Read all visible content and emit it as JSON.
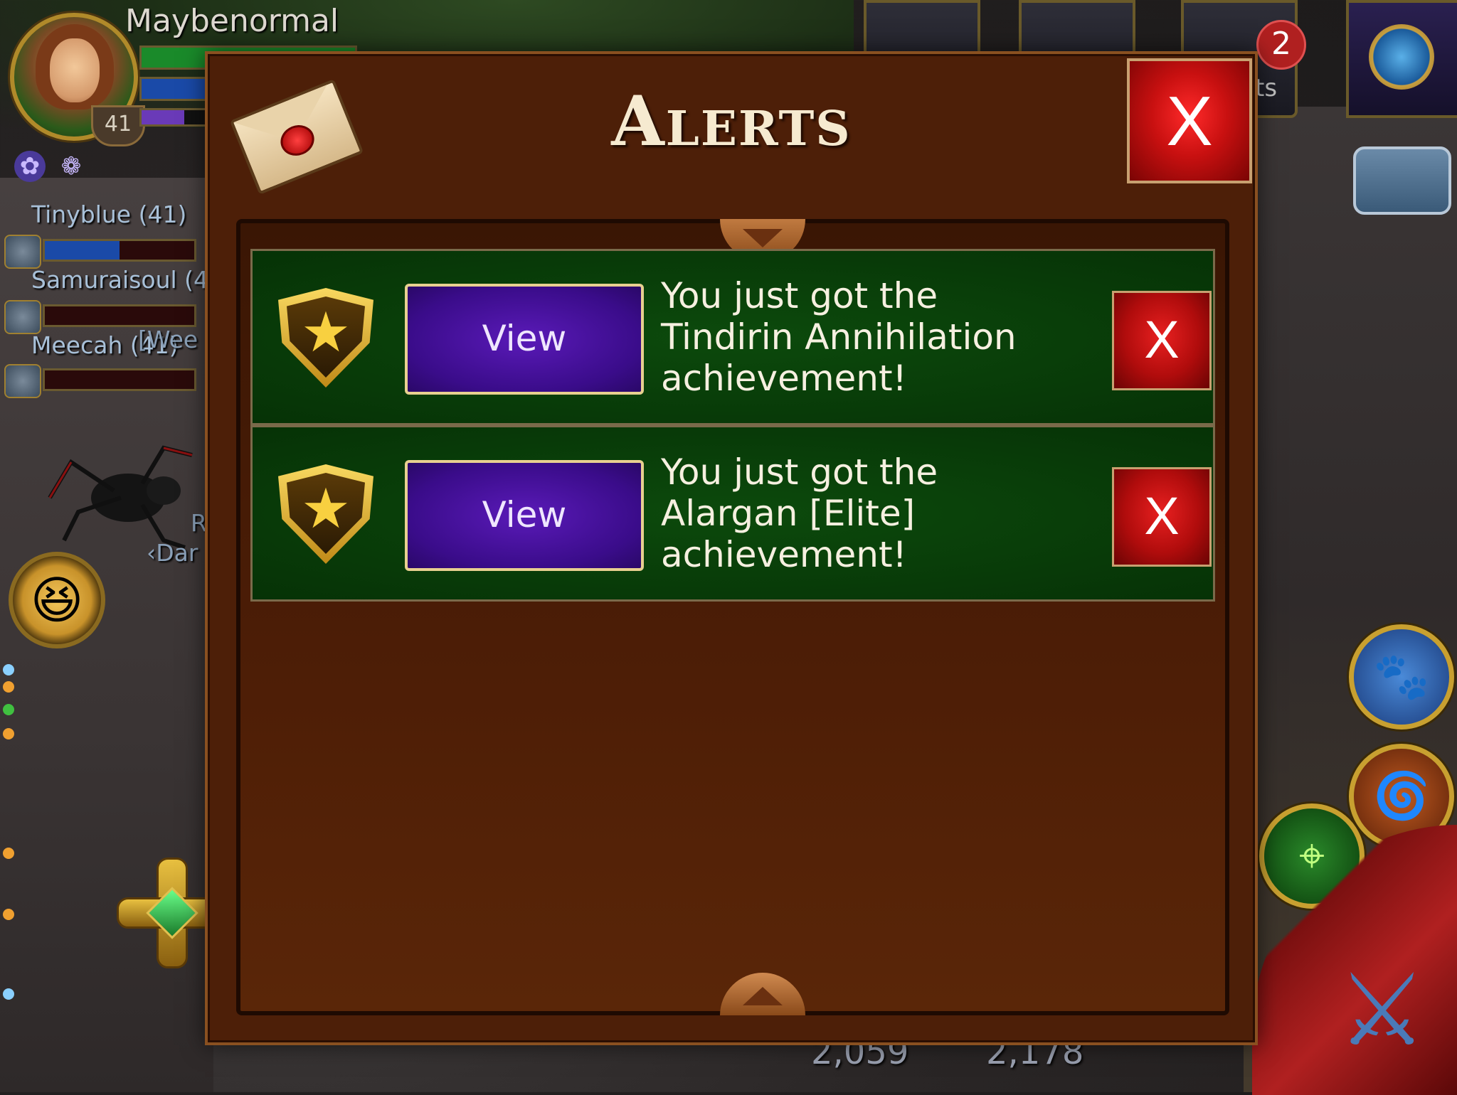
{
  "hud": {
    "player_name": "Maybenormal",
    "player_level": "41",
    "party": [
      {
        "name": "Tinyblue (41)"
      },
      {
        "name": "Samuraisoul (4"
      },
      {
        "name": "Meecah (41)"
      }
    ],
    "target_label_partial": "R",
    "guild_label_partial": "‹Dar",
    "overlap_text": "[Wee",
    "mail_badge_count": "2",
    "top_button_partial_label": "ts",
    "stat_left": "2,059",
    "stat_right": "2,178",
    "icons": {
      "emote": "laughing-face-icon",
      "pet": "paw-icon",
      "compass": "compass-icon",
      "chat": "chat-bubble-icon"
    }
  },
  "alerts": {
    "title": "Alerts",
    "close_label": "X",
    "items": [
      {
        "view_label": "View",
        "message": "You just got the\nTindirin Annihilation\nachievement!",
        "dismiss_label": "X"
      },
      {
        "view_label": "View",
        "message": "You just got the\nAlargan [Elite]\nachievement!",
        "dismiss_label": "X"
      }
    ]
  },
  "colors": {
    "window_bg": "#4d1f08",
    "row_bg": "#0c4a0c",
    "view_button": "#5a1ab8",
    "close_button": "#c81010",
    "title_text": "#f6ead0"
  }
}
